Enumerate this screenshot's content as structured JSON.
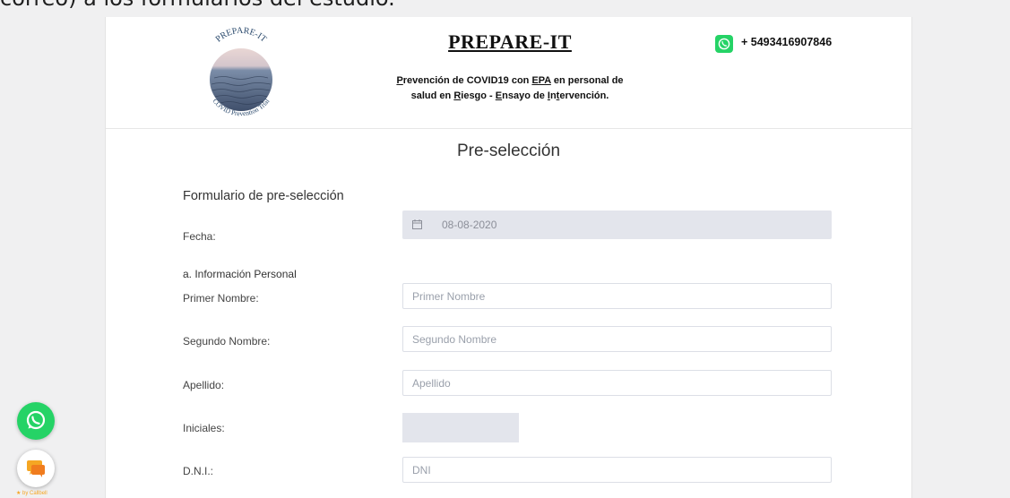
{
  "page": {
    "top_text": "correo) a los formularios del estudio."
  },
  "header": {
    "logo_text_top": "PREPARE-IT",
    "logo_text_bottom": "COVID Prevention Trial",
    "title": "PREPARE-IT",
    "subtitle_parts": {
      "p1": "P",
      "p2": "revención de COVID19 con ",
      "p3": "EPA",
      "p4": " en personal de",
      "p5": "salud en ",
      "p6": "R",
      "p7": "iesgo - ",
      "p8": "E",
      "p9": "nsayo de ",
      "p10": "I",
      "p11": "n",
      "p12": "t",
      "p13": "ervención."
    },
    "phone": "+ 5493416907846"
  },
  "section_title": "Pre-selección",
  "form": {
    "title": "Formulario de pre-selección",
    "fecha_label": "Fecha:",
    "fecha_value": "08-08-2020",
    "personal_heading": "a. Información Personal",
    "primer_nombre_label": "Primer Nombre:",
    "primer_nombre_placeholder": "Primer Nombre",
    "segundo_nombre_label": "Segundo Nombre:",
    "segundo_nombre_placeholder": "Segundo Nombre",
    "apellido_label": "Apellido:",
    "apellido_placeholder": "Apellido",
    "iniciales_label": "Iniciales:",
    "dni_label": "D.N.I.:",
    "dni_placeholder": "DNI"
  },
  "widgets": {
    "callbell_text": "by Callbell"
  },
  "colors": {
    "whatsapp": "#25d366",
    "input_disabled_bg": "#e3e5ec",
    "callbell": "#f5a623"
  },
  "icons": [
    "whatsapp-icon",
    "calendar-icon",
    "chat-icon",
    "logo-emblem"
  ]
}
